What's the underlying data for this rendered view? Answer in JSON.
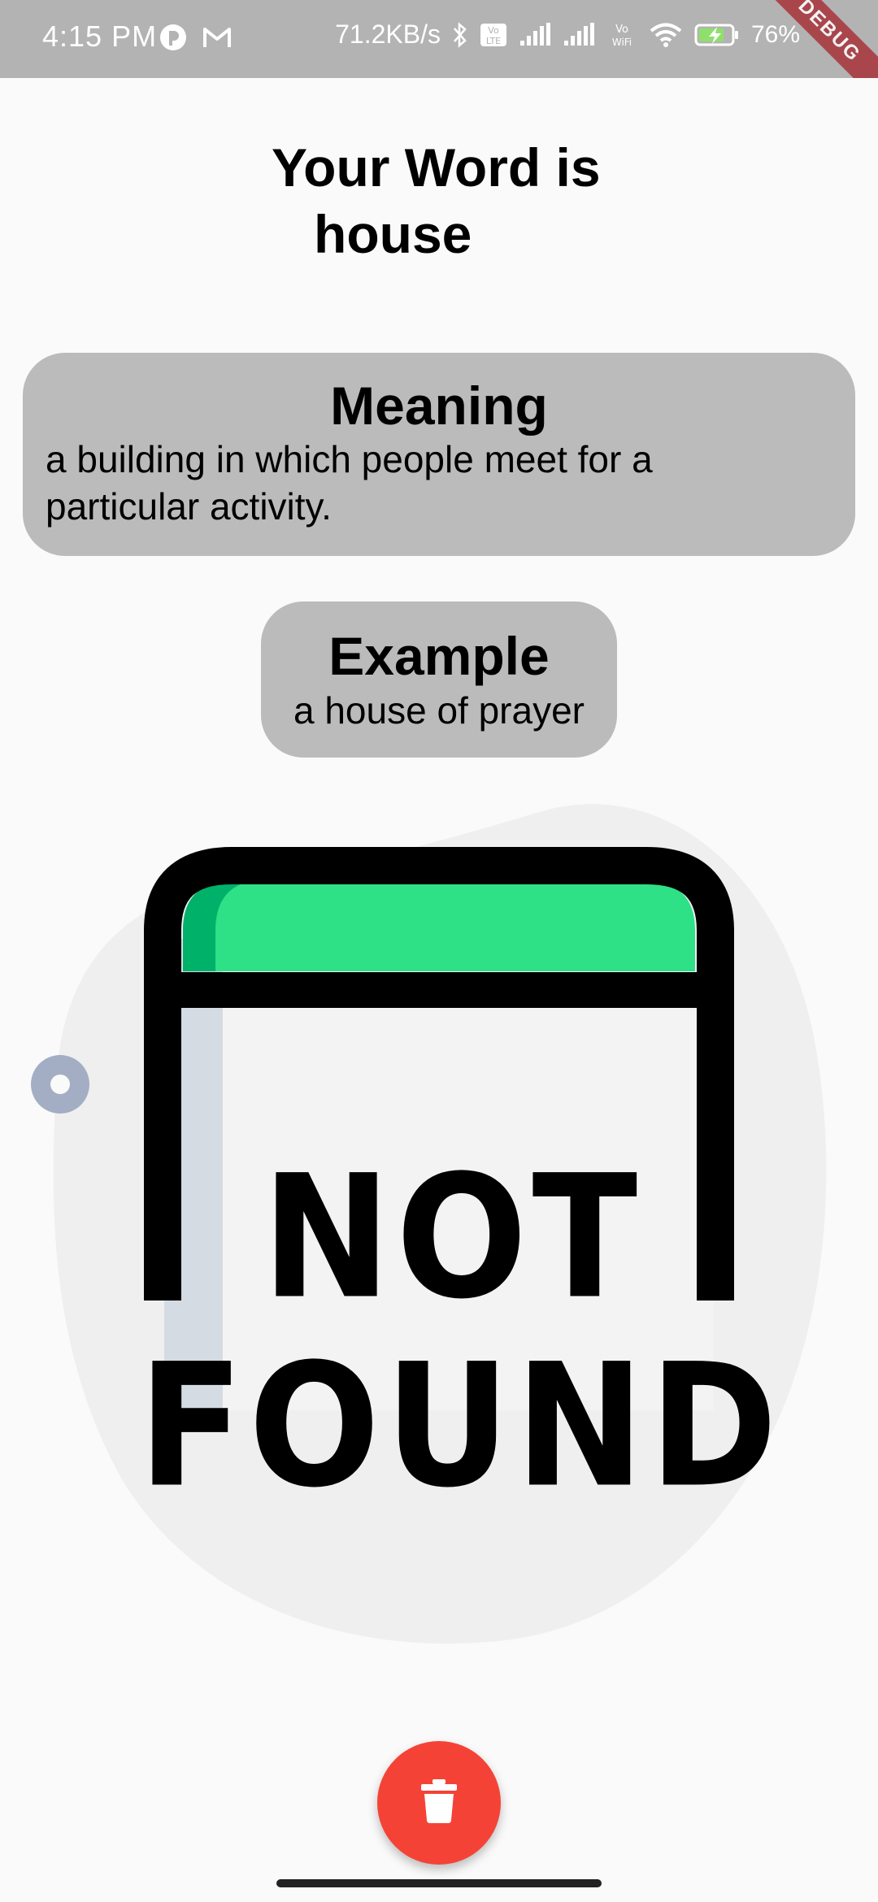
{
  "status_bar": {
    "time": "4:15 PM",
    "net_speed": "71.2KB/s",
    "battery_percent": "76%",
    "debug_label": "DEBUG",
    "icons": [
      "app-notification-icon",
      "gmail-icon",
      "bluetooth-icon",
      "volte-icon",
      "signal-icon",
      "signal-icon",
      "vowifi-icon",
      "wifi-icon",
      "battery-charging-icon"
    ]
  },
  "word": {
    "heading_line1": "Your Word is",
    "heading_line2": "house"
  },
  "meaning": {
    "title": "Meaning",
    "text": "a building in which people meet for a particular activity."
  },
  "example": {
    "title": "Example",
    "text": "a house of prayer"
  },
  "illustration": {
    "line1": "NOT",
    "line2": "FOUND",
    "colors": {
      "bar": "#2ee086",
      "bar_shade": "#00b16a",
      "frame": "#000000",
      "blob": "#efefef",
      "ring": "#a3aec4"
    }
  },
  "fab": {
    "icon": "trash-icon",
    "color": "#f44336"
  }
}
